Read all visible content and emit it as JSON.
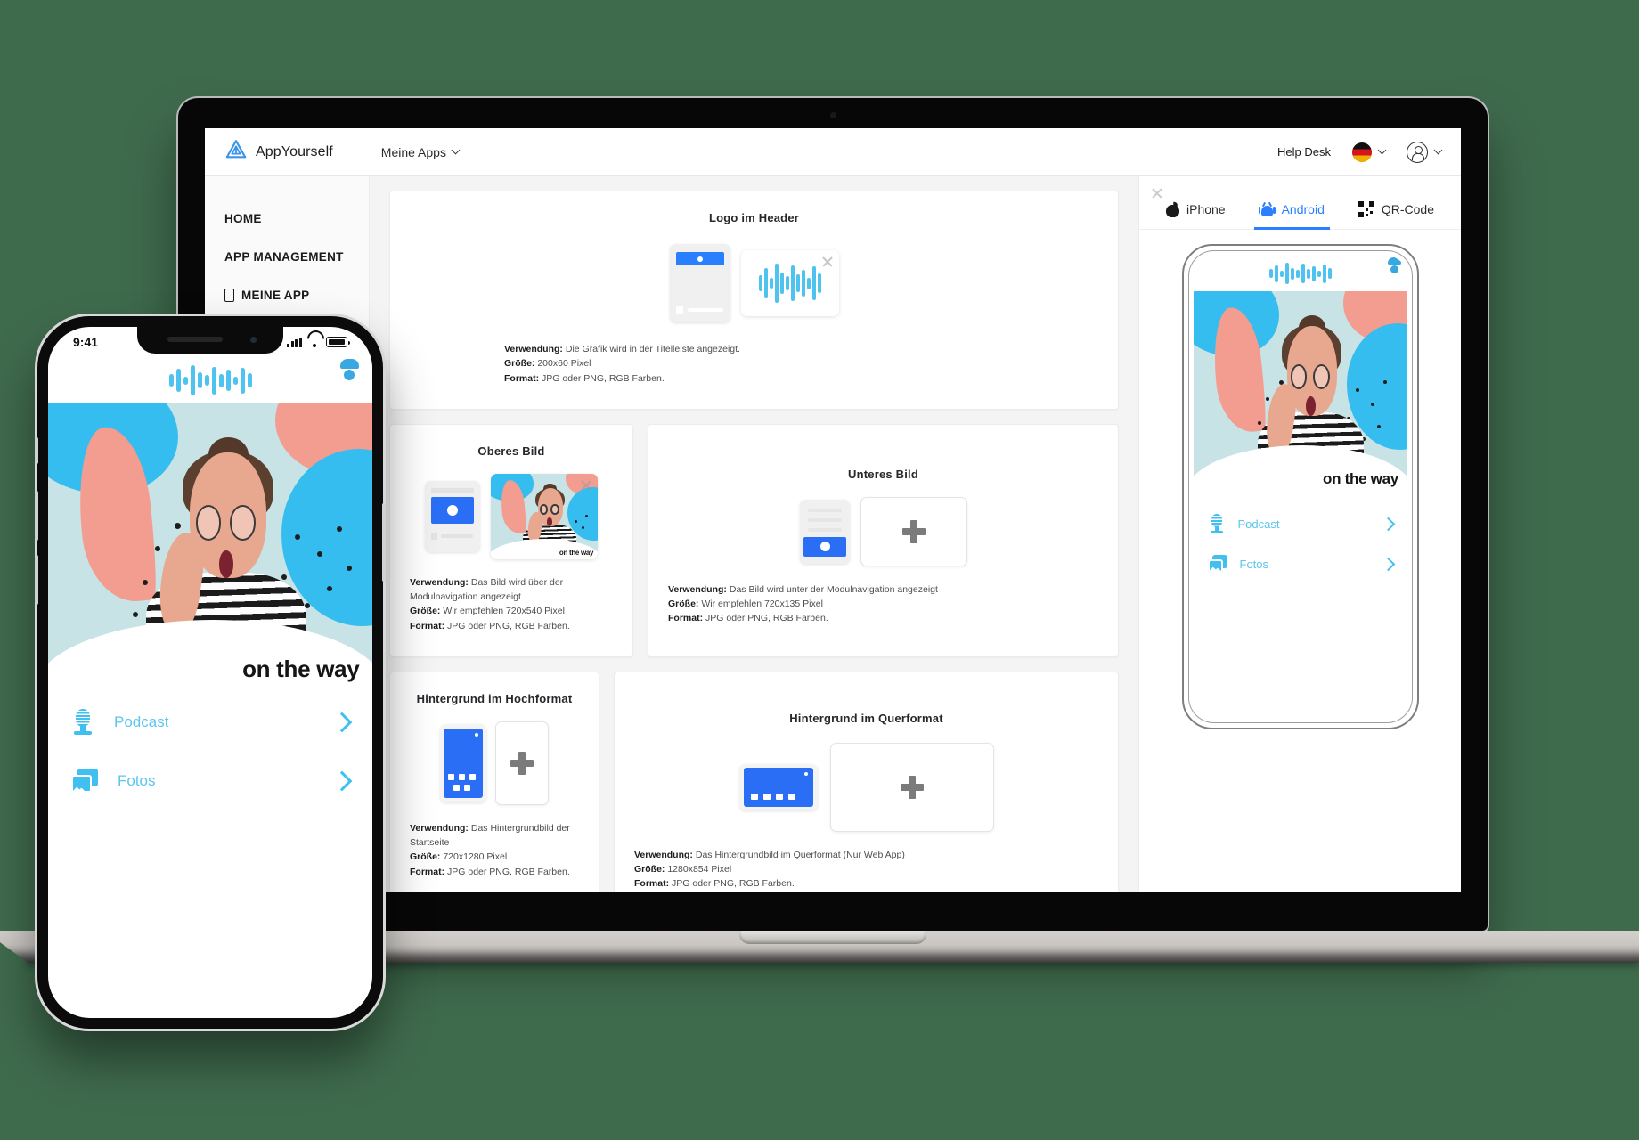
{
  "background_color": "#3f6b4d",
  "accent_color": "#2a7fff",
  "brand_cyan": "#4ec3ef",
  "app": {
    "header": {
      "logo_icon": "appyourself-triangle-logo",
      "brand_name": "AppYourself",
      "nav_label": "Meine Apps",
      "nav_chevron_icon": "chevron-down-icon",
      "help_desk_label": "Help Desk",
      "language_flag": "german-flag-icon",
      "language_chevron_icon": "chevron-down-icon",
      "account_icon": "user-circle-icon",
      "account_chevron_icon": "chevron-down-icon"
    },
    "sidebar": {
      "items": [
        {
          "label": "HOME",
          "icon": null
        },
        {
          "label": "APP MANAGEMENT",
          "icon": null
        },
        {
          "label": "MEINE APP",
          "icon": "phone-outline-icon"
        }
      ]
    },
    "cards": [
      {
        "id": "logo-im-header",
        "title": "Logo im Header",
        "preview_icon": "phone-header-wireframe",
        "asset_icon": "audio-wave-logo",
        "has_remove": true,
        "remove_icon": "close-icon",
        "meta": [
          {
            "label": "Verwendung:",
            "value": "Die Grafik wird in der Titelleiste angezeigt."
          },
          {
            "label": "Größe:",
            "value": "200x60 Pixel"
          },
          {
            "label": "Format:",
            "value": "JPG oder PNG, RGB Farben."
          }
        ]
      },
      {
        "id": "oberes-bild",
        "title": "Oberes Bild",
        "preview_icon": "phone-top-image-wireframe",
        "asset_icon": "hero-photo-thumbnail",
        "has_remove": true,
        "remove_icon": "close-icon",
        "slogan": "on the way",
        "meta": [
          {
            "label": "Verwendung:",
            "value": "Das Bild wird über der Modulnavigation angezeigt"
          },
          {
            "label": "Größe:",
            "value": "Wir empfehlen 720x540 Pixel"
          },
          {
            "label": "Format:",
            "value": "JPG oder PNG, RGB Farben."
          }
        ]
      },
      {
        "id": "unteres-bild",
        "title": "Unteres Bild",
        "preview_icon": "phone-bottom-image-wireframe",
        "upload_icon": "plus-icon",
        "has_remove": false,
        "meta": [
          {
            "label": "Verwendung:",
            "value": "Das Bild wird unter der Modulnavigation angezeigt"
          },
          {
            "label": "Größe:",
            "value": "Wir empfehlen 720x135 Pixel"
          },
          {
            "label": "Format:",
            "value": "JPG oder PNG, RGB Farben."
          }
        ]
      },
      {
        "id": "hintergrund-hochformat",
        "title": "Hintergrund im Hochformat",
        "preview_icon": "phone-portrait-wireframe",
        "upload_icon": "plus-icon",
        "has_remove": false,
        "meta": [
          {
            "label": "Verwendung:",
            "value": "Das Hintergrundbild der Startseite"
          },
          {
            "label": "Größe:",
            "value": "720x1280 Pixel"
          },
          {
            "label": "Format:",
            "value": "JPG oder PNG, RGB Farben."
          }
        ]
      },
      {
        "id": "hintergrund-querformat",
        "title": "Hintergrund im Querformat",
        "preview_icon": "phone-landscape-wireframe",
        "upload_icon": "plus-icon",
        "has_remove": false,
        "meta": [
          {
            "label": "Verwendung:",
            "value": "Das Hintergrundbild im Querformat (Nur Web App)"
          },
          {
            "label": "Größe:",
            "value": "1280x854 Pixel"
          },
          {
            "label": "Format:",
            "value": "JPG oder PNG, RGB Farben."
          }
        ]
      }
    ],
    "preview_panel": {
      "close_icon": "close-icon",
      "tabs": [
        {
          "label": "iPhone",
          "icon": "apple-icon",
          "active": false
        },
        {
          "label": "Android",
          "icon": "android-icon",
          "active": true
        },
        {
          "label": "QR-Code",
          "icon": "qr-code-icon",
          "active": false
        }
      ],
      "phone": {
        "header_logo_icon": "audio-wave-logo",
        "header_user_icon": "user-icon",
        "hero_slogan": "on the way",
        "modules": [
          {
            "label": "Podcast",
            "icon": "microphone-icon",
            "chevron": "chevron-right-icon"
          },
          {
            "label": "Fotos",
            "icon": "photos-icon",
            "chevron": "chevron-right-icon"
          }
        ]
      }
    }
  },
  "iphone_mockup": {
    "status_bar": {
      "time": "9:41",
      "signal_icon": "cellular-signal-icon",
      "wifi_icon": "wifi-icon",
      "battery_icon": "battery-full-icon"
    },
    "header_logo_icon": "audio-wave-logo",
    "header_user_icon": "user-icon",
    "hero_slogan": "on the way",
    "modules": [
      {
        "label": "Podcast",
        "icon": "microphone-icon",
        "chevron": "chevron-right-icon"
      },
      {
        "label": "Fotos",
        "icon": "photos-icon",
        "chevron": "chevron-right-icon"
      }
    ]
  }
}
